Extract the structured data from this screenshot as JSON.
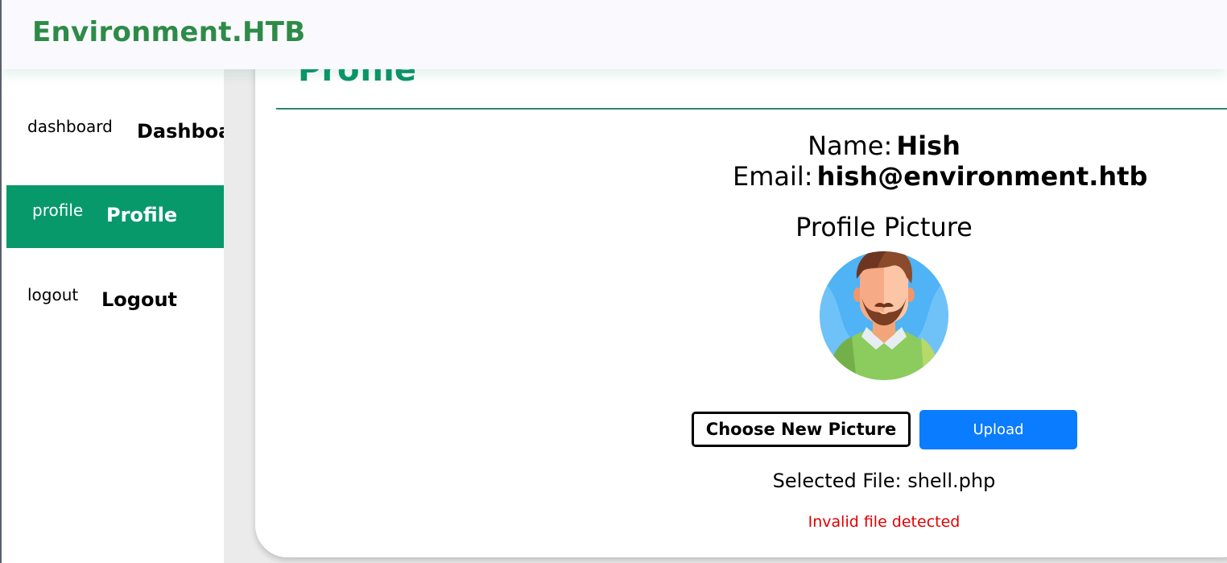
{
  "header": {
    "brand": "Environment.HTB"
  },
  "sidebar": {
    "items": [
      {
        "icon_text": "dashboard",
        "label": "Dashboard",
        "active": false
      },
      {
        "icon_text": "profile",
        "label": "Profile",
        "active": true
      },
      {
        "icon_text": "logout",
        "label": "Logout",
        "active": false
      }
    ]
  },
  "main": {
    "title": "Profile",
    "name_label": "Name:",
    "name_value": "Hish",
    "email_label": "Email:",
    "email_value": "hish@environment.htb",
    "picture_title": "Profile Picture",
    "avatar_icon": "male-avatar-illustration",
    "choose_label": "Choose New Picture",
    "upload_label": "Upload",
    "selected_file": "Selected File: shell.php",
    "error_message": "Invalid file detected"
  },
  "colors": {
    "brand": "#2e8b47",
    "accent": "#08996a",
    "title": "#0b9568",
    "upload_button": "#0a7cff",
    "error": "#e00000"
  }
}
